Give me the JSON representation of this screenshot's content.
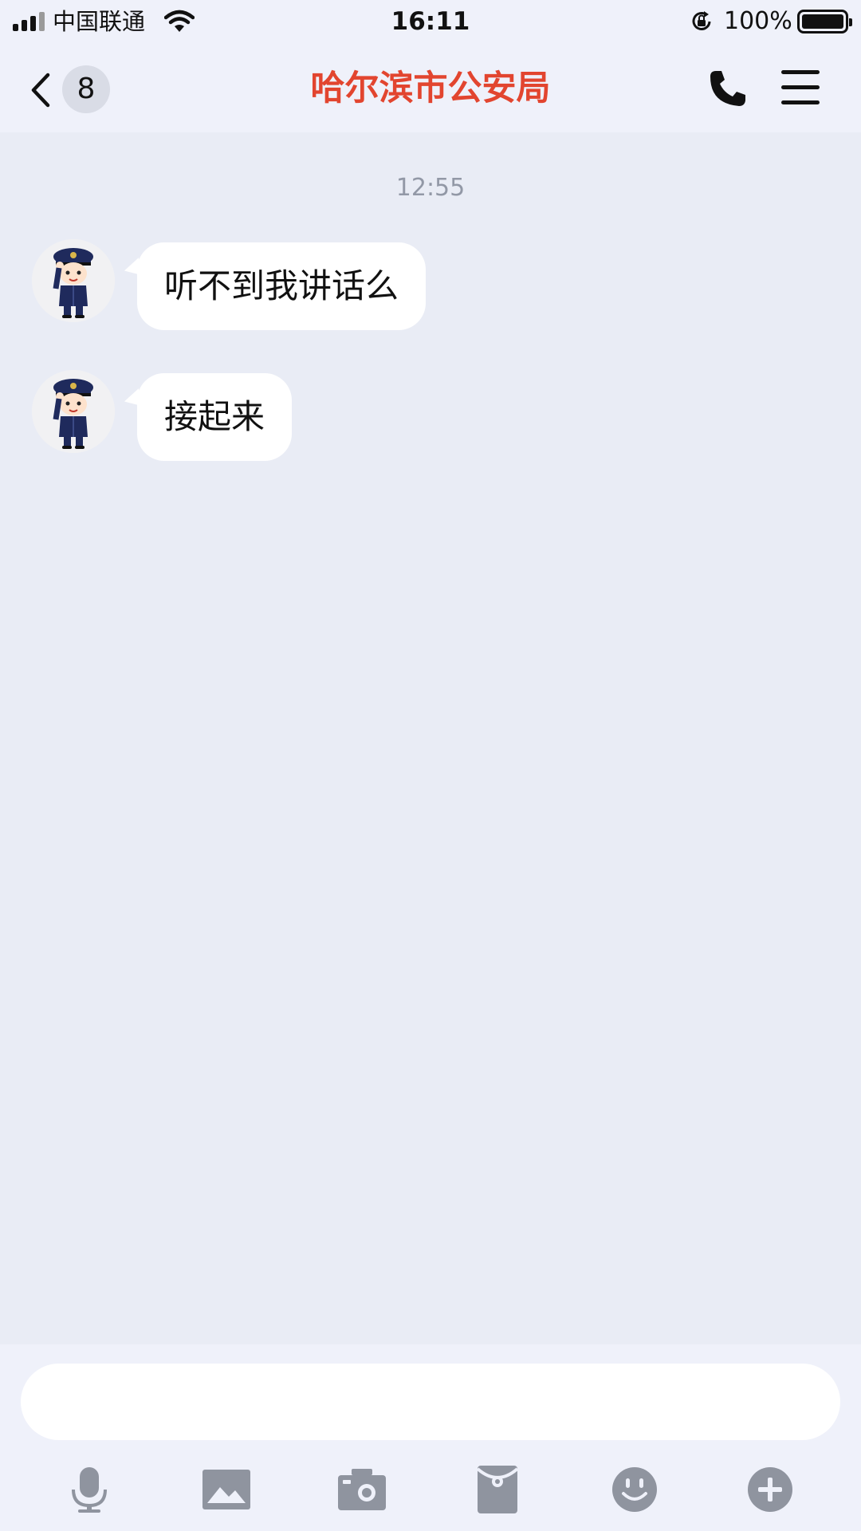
{
  "status_bar": {
    "carrier": "中国联通",
    "time": "16:11",
    "battery_percent": "100%",
    "battery_level": 1.0,
    "icons": [
      "signal-icon",
      "wifi-icon",
      "rotation-lock-icon",
      "battery-icon"
    ]
  },
  "nav": {
    "back_count": "8",
    "title": "哈尔滨市公安局",
    "title_color": "#e2452f",
    "icons": [
      "back-chevron-icon",
      "phone-icon",
      "menu-icon"
    ]
  },
  "chat": {
    "timestamp": "12:55",
    "messages": [
      {
        "sender": "avatar-police-officer",
        "text": "听不到我讲话么"
      },
      {
        "sender": "avatar-police-officer",
        "text": "接起来"
      }
    ]
  },
  "composer": {
    "input_value": "",
    "tools": [
      "microphone-icon",
      "image-icon",
      "camera-icon",
      "red-packet-icon",
      "emoji-icon",
      "plus-icon"
    ]
  },
  "colors": {
    "background": "#e9ecf5",
    "bar": "#eff1fa",
    "bubble": "#ffffff",
    "tool_icon": "#8f949f"
  }
}
